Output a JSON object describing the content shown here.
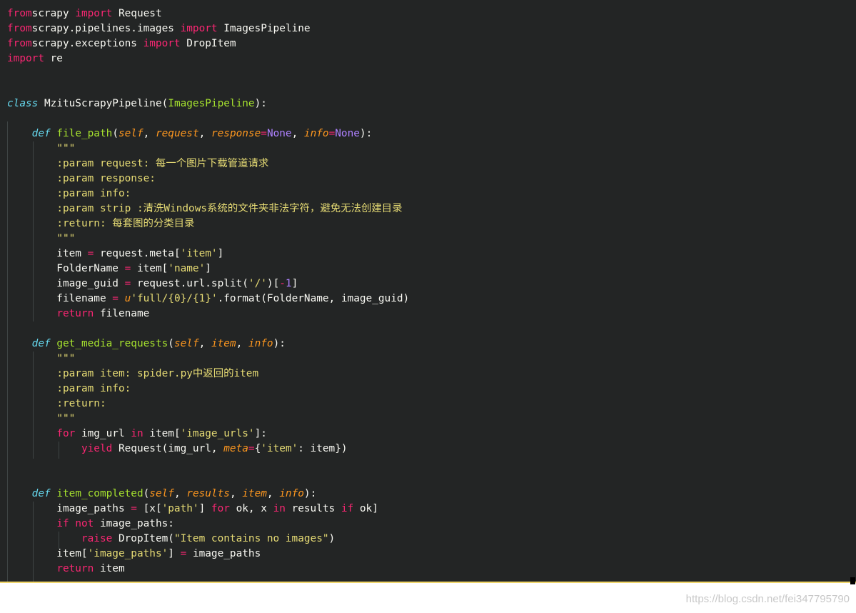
{
  "colors": {
    "background": "#232525",
    "keyword": "#f92672",
    "def_keyword": "#66d9ef",
    "function_name": "#a6e22e",
    "parameter": "#fd971f",
    "string": "#e6db74",
    "number": "#ae81ff",
    "text": "#f8f8f2"
  },
  "watermark": "https://blog.csdn.net/fei347795790",
  "code_lines": [
    [
      [
        "kw",
        "from"
      ],
      [
        "",
        "scrapy "
      ],
      [
        "kw",
        "import"
      ],
      [
        "",
        " Request"
      ]
    ],
    [
      [
        "kw",
        "from"
      ],
      [
        "",
        "scrapy.pipelines.images "
      ],
      [
        "kw",
        "import"
      ],
      [
        "",
        " ImagesPipeline"
      ]
    ],
    [
      [
        "kw",
        "from"
      ],
      [
        "",
        "scrapy.exceptions "
      ],
      [
        "kw",
        "import"
      ],
      [
        "",
        " DropItem"
      ]
    ],
    [
      [
        "kw",
        "import"
      ],
      [
        "",
        " re"
      ]
    ],
    [],
    [],
    [
      [
        "df",
        "class"
      ],
      [
        "",
        " MzituScrapyPipeline("
      ],
      [
        "fn",
        "ImagesPipeline"
      ],
      [
        "",
        "):"
      ]
    ],
    [],
    [
      [
        "",
        "    "
      ],
      [
        "df",
        "def"
      ],
      [
        "",
        " "
      ],
      [
        "fn",
        "file_path"
      ],
      [
        "",
        "("
      ],
      [
        "pa",
        "self"
      ],
      [
        "",
        ", "
      ],
      [
        "pa",
        "request"
      ],
      [
        "",
        ", "
      ],
      [
        "pa",
        "response"
      ],
      [
        "kw",
        "="
      ],
      [
        "nu",
        "None"
      ],
      [
        "",
        ", "
      ],
      [
        "pa",
        "info"
      ],
      [
        "kw",
        "="
      ],
      [
        "nu",
        "None"
      ],
      [
        "",
        "):"
      ]
    ],
    [
      [
        "",
        "        "
      ],
      [
        "cm",
        "\"\"\""
      ]
    ],
    [
      [
        "",
        "        "
      ],
      [
        "cm",
        ":param request: 每一个图片下载管道请求"
      ]
    ],
    [
      [
        "",
        "        "
      ],
      [
        "cm",
        ":param response:"
      ]
    ],
    [
      [
        "",
        "        "
      ],
      [
        "cm",
        ":param info:"
      ]
    ],
    [
      [
        "",
        "        "
      ],
      [
        "cm",
        ":param strip :清洗Windows系统的文件夹非法字符，避免无法创建目录"
      ]
    ],
    [
      [
        "",
        "        "
      ],
      [
        "cm",
        ":return: 每套图的分类目录"
      ]
    ],
    [
      [
        "",
        "        "
      ],
      [
        "cm",
        "\"\"\""
      ]
    ],
    [
      [
        "",
        "        item "
      ],
      [
        "kw",
        "="
      ],
      [
        "",
        " request.meta["
      ],
      [
        "st",
        "'item'"
      ],
      [
        "",
        "]"
      ]
    ],
    [
      [
        "",
        "        FolderName "
      ],
      [
        "kw",
        "="
      ],
      [
        "",
        " item["
      ],
      [
        "st",
        "'name'"
      ],
      [
        "",
        "]"
      ]
    ],
    [
      [
        "",
        "        image_guid "
      ],
      [
        "kw",
        "="
      ],
      [
        "",
        " request.url.split("
      ],
      [
        "st",
        "'/'"
      ],
      [
        "",
        ")["
      ],
      [
        "kw",
        "-"
      ],
      [
        "nu",
        "1"
      ],
      [
        "",
        "]"
      ]
    ],
    [
      [
        "",
        "        filename "
      ],
      [
        "kw",
        "="
      ],
      [
        "",
        " "
      ],
      [
        "pa",
        "u"
      ],
      [
        "st",
        "'full/{0}/{1}'"
      ],
      [
        "",
        ".format(FolderName, image_guid)"
      ]
    ],
    [
      [
        "",
        "        "
      ],
      [
        "kw",
        "return"
      ],
      [
        "",
        " filename"
      ]
    ],
    [],
    [
      [
        "",
        "    "
      ],
      [
        "df",
        "def"
      ],
      [
        "",
        " "
      ],
      [
        "fn",
        "get_media_requests"
      ],
      [
        "",
        "("
      ],
      [
        "pa",
        "self"
      ],
      [
        "",
        ", "
      ],
      [
        "pa",
        "item"
      ],
      [
        "",
        ", "
      ],
      [
        "pa",
        "info"
      ],
      [
        "",
        "):"
      ]
    ],
    [
      [
        "",
        "        "
      ],
      [
        "cm",
        "\"\"\""
      ]
    ],
    [
      [
        "",
        "        "
      ],
      [
        "cm",
        ":param item: spider.py中返回的item"
      ]
    ],
    [
      [
        "",
        "        "
      ],
      [
        "cm",
        ":param info:"
      ]
    ],
    [
      [
        "",
        "        "
      ],
      [
        "cm",
        ":return:"
      ]
    ],
    [
      [
        "",
        "        "
      ],
      [
        "cm",
        "\"\"\""
      ]
    ],
    [
      [
        "",
        "        "
      ],
      [
        "kw",
        "for"
      ],
      [
        "",
        " img_url "
      ],
      [
        "kw",
        "in"
      ],
      [
        "",
        " item["
      ],
      [
        "st",
        "'image_urls'"
      ],
      [
        "",
        "]:"
      ]
    ],
    [
      [
        "",
        "            "
      ],
      [
        "kw",
        "yield"
      ],
      [
        "",
        " Request(img_url, "
      ],
      [
        "pa",
        "meta"
      ],
      [
        "kw",
        "="
      ],
      [
        "",
        "{"
      ],
      [
        "st",
        "'item'"
      ],
      [
        "",
        ": item})"
      ]
    ],
    [],
    [],
    [
      [
        "",
        "    "
      ],
      [
        "df",
        "def"
      ],
      [
        "",
        " "
      ],
      [
        "fn",
        "item_completed"
      ],
      [
        "",
        "("
      ],
      [
        "pa",
        "self"
      ],
      [
        "",
        ", "
      ],
      [
        "pa",
        "results"
      ],
      [
        "",
        ", "
      ],
      [
        "pa",
        "item"
      ],
      [
        "",
        ", "
      ],
      [
        "pa",
        "info"
      ],
      [
        "",
        "):"
      ]
    ],
    [
      [
        "",
        "        image_paths "
      ],
      [
        "kw",
        "="
      ],
      [
        "",
        " [x["
      ],
      [
        "st",
        "'path'"
      ],
      [
        "",
        "] "
      ],
      [
        "kw",
        "for"
      ],
      [
        "",
        " ok, x "
      ],
      [
        "kw",
        "in"
      ],
      [
        "",
        " results "
      ],
      [
        "kw",
        "if"
      ],
      [
        "",
        " ok]"
      ]
    ],
    [
      [
        "",
        "        "
      ],
      [
        "kw",
        "if"
      ],
      [
        "",
        " "
      ],
      [
        "kw",
        "not"
      ],
      [
        "",
        " image_paths:"
      ]
    ],
    [
      [
        "",
        "            "
      ],
      [
        "kw",
        "raise"
      ],
      [
        "",
        " DropItem("
      ],
      [
        "st",
        "\"Item contains no images\""
      ],
      [
        "",
        ")"
      ]
    ],
    [
      [
        "",
        "        item["
      ],
      [
        "st",
        "'image_paths'"
      ],
      [
        "",
        "] "
      ],
      [
        "kw",
        "="
      ],
      [
        "",
        " image_paths"
      ]
    ],
    [
      [
        "",
        "        "
      ],
      [
        "kw",
        "return"
      ],
      [
        "",
        " item"
      ]
    ]
  ]
}
